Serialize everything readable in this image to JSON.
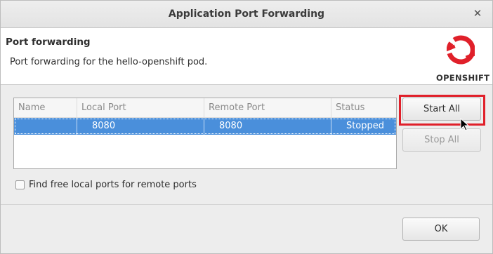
{
  "window": {
    "title": "Application Port Forwarding"
  },
  "header": {
    "title": "Port forwarding",
    "description": "Port forwarding for the hello-openshift pod.",
    "logo_text": "OPENSHIFT",
    "logo_color": "#e0202a"
  },
  "table": {
    "columns": [
      "Name",
      "Local Port",
      "Remote Port",
      "Status"
    ],
    "rows": [
      {
        "name": "",
        "local_port": "8080",
        "remote_port": "8080",
        "status": "Stopped",
        "selected": true
      }
    ]
  },
  "buttons": {
    "start_all": "Start All",
    "stop_all": "Stop All",
    "ok": "OK"
  },
  "options": {
    "find_free_ports_label": "Find free local ports for remote ports",
    "find_free_ports_checked": false
  },
  "colors": {
    "selection": "#4a8fdb",
    "highlight": "#e0202a"
  },
  "icons": {
    "close": "close-icon",
    "logo": "openshift-logo-icon",
    "cursor": "mouse-cursor-icon"
  }
}
